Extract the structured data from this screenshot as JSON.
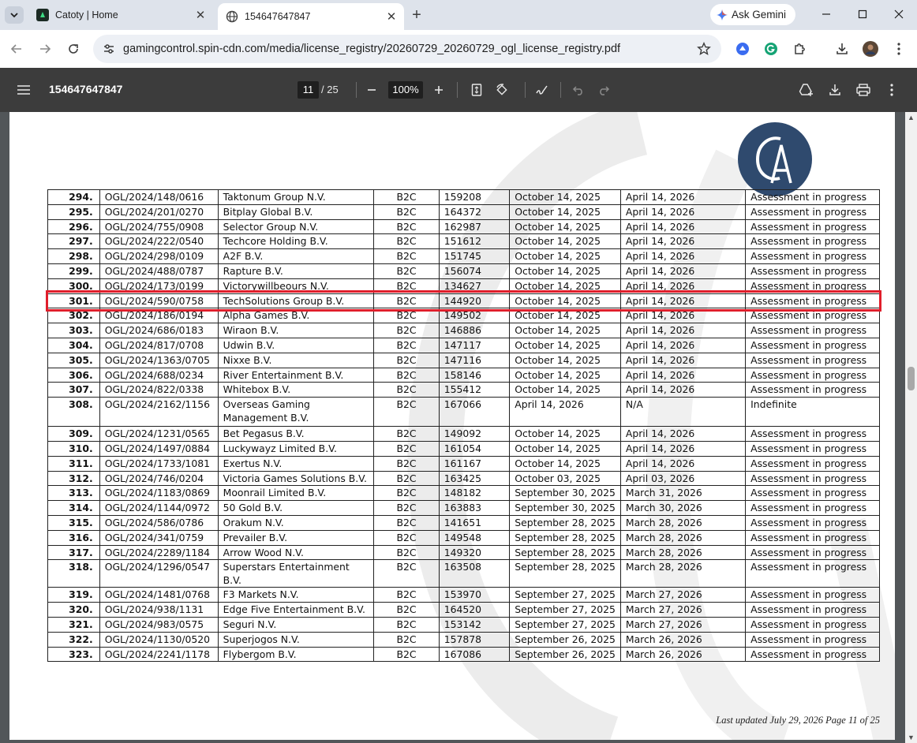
{
  "browser": {
    "tabs": [
      {
        "title": "Catoty | Home",
        "active": false
      },
      {
        "title": "154647647847",
        "active": true
      }
    ],
    "gemini_label": "Ask Gemini",
    "url": "gamingcontrol.spin-cdn.com/media/license_registry/20260729_20260729_ogl_license_registry.pdf"
  },
  "pdf_toolbar": {
    "title": "154647647847",
    "page_current": "11",
    "page_total": "/ 25",
    "zoom": "100%"
  },
  "registry": {
    "rows": [
      {
        "num": "294.",
        "license": "OGL/2024/148/0616",
        "company": "Taktonum Group N.V.",
        "type": "B2C",
        "id": "159208",
        "date1": "October 14, 2025",
        "date2": "April 14, 2026",
        "status": "Assessment in progress"
      },
      {
        "num": "295.",
        "license": "OGL/2024/201/0270",
        "company": "Bitplay Global B.V.",
        "type": "B2C",
        "id": "164372",
        "date1": "October 14, 2025",
        "date2": "April 14, 2026",
        "status": "Assessment in progress"
      },
      {
        "num": "296.",
        "license": "OGL/2024/755/0908",
        "company": "Selector Group N.V.",
        "type": "B2C",
        "id": "162987",
        "date1": "October 14, 2025",
        "date2": "April 14, 2026",
        "status": "Assessment in progress"
      },
      {
        "num": "297.",
        "license": "OGL/2024/222/0540",
        "company": "Techcore Holding B.V.",
        "type": "B2C",
        "id": "151612",
        "date1": "October 14, 2025",
        "date2": "April 14, 2026",
        "status": "Assessment in progress"
      },
      {
        "num": "298.",
        "license": "OGL/2024/298/0109",
        "company": "A2F B.V.",
        "type": "B2C",
        "id": "151745",
        "date1": "October 14, 2025",
        "date2": "April 14, 2026",
        "status": "Assessment in progress"
      },
      {
        "num": "299.",
        "license": "OGL/2024/488/0787",
        "company": "Rapture B.V.",
        "type": "B2C",
        "id": "156074",
        "date1": "October 14, 2025",
        "date2": "April 14, 2026",
        "status": "Assessment in progress"
      },
      {
        "num": "300.",
        "license": "OGL/2024/173/0199",
        "company": "Victorywillbeours N.V.",
        "type": "B2C",
        "id": "134627",
        "date1": "October 14, 2025",
        "date2": "April 14, 2026",
        "status": "Assessment in progress"
      },
      {
        "num": "301.",
        "license": "OGL/2024/590/0758",
        "company": "TechSolutions Group B.V.",
        "type": "B2C",
        "id": "144920",
        "date1": "October 14, 2025",
        "date2": "April 14, 2026",
        "status": "Assessment in progress"
      },
      {
        "num": "302.",
        "license": "OGL/2024/186/0194",
        "company": "Alpha Games B.V.",
        "type": "B2C",
        "id": "149502",
        "date1": "October 14, 2025",
        "date2": "April 14, 2026",
        "status": "Assessment in progress"
      },
      {
        "num": "303.",
        "license": "OGL/2024/686/0183",
        "company": "Wiraon B.V.",
        "type": "B2C",
        "id": "146886",
        "date1": "October 14, 2025",
        "date2": "April 14, 2026",
        "status": "Assessment in progress"
      },
      {
        "num": "304.",
        "license": "OGL/2024/817/0708",
        "company": "Udwin B.V.",
        "type": "B2C",
        "id": "147117",
        "date1": "October 14, 2025",
        "date2": "April 14, 2026",
        "status": "Assessment in progress"
      },
      {
        "num": "305.",
        "license": "OGL/2024/1363/0705",
        "company": "Nixxe B.V.",
        "type": "B2C",
        "id": "147116",
        "date1": "October 14, 2025",
        "date2": "April 14, 2026",
        "status": "Assessment in progress"
      },
      {
        "num": "306.",
        "license": "OGL/2024/688/0234",
        "company": "River Entertainment B.V.",
        "type": "B2C",
        "id": "158146",
        "date1": "October 14, 2025",
        "date2": "April 14, 2026",
        "status": "Assessment in progress"
      },
      {
        "num": "307.",
        "license": "OGL/2024/822/0338",
        "company": "Whitebox B.V.",
        "type": "B2C",
        "id": "155412",
        "date1": "October 14, 2025",
        "date2": "April 14, 2026",
        "status": "Assessment in progress"
      },
      {
        "num": "308.",
        "license": "OGL/2024/2162/1156",
        "company": "Overseas Gaming Management B.V.",
        "type": "B2C",
        "id": "167066",
        "date1": "April 14, 2026",
        "date2": "N/A",
        "status": "Indefinite"
      },
      {
        "num": "309.",
        "license": "OGL/2024/1231/0565",
        "company": "Bet Pegasus B.V.",
        "type": "B2C",
        "id": "149092",
        "date1": "October 14, 2025",
        "date2": "April 14, 2026",
        "status": "Assessment in progress"
      },
      {
        "num": "310.",
        "license": "OGL/2024/1497/0884",
        "company": "Luckywayz Limited B.V.",
        "type": "B2C",
        "id": "161054",
        "date1": "October 14, 2025",
        "date2": "April 14, 2026",
        "status": "Assessment in progress"
      },
      {
        "num": "311.",
        "license": "OGL/2024/1733/1081",
        "company": "Exertus N.V.",
        "type": "B2C",
        "id": "161167",
        "date1": "October 14, 2025",
        "date2": "April 14, 2026",
        "status": "Assessment in progress"
      },
      {
        "num": "312.",
        "license": "OGL/2024/746/0204",
        "company": "Victoria Games Solutions B.V.",
        "type": "B2C",
        "id": "163425",
        "date1": "October 03, 2025",
        "date2": "April 03, 2026",
        "status": "Assessment in progress"
      },
      {
        "num": "313.",
        "license": "OGL/2024/1183/0869",
        "company": "Moonrail Limited B.V.",
        "type": "B2C",
        "id": "148182",
        "date1": "September 30, 2025",
        "date2": "March 31, 2026",
        "status": "Assessment in progress"
      },
      {
        "num": "314.",
        "license": "OGL/2024/1144/0972",
        "company": "50 Gold B.V.",
        "type": "B2C",
        "id": "163883",
        "date1": "September 30, 2025",
        "date2": "March 30, 2026",
        "status": "Assessment in progress"
      },
      {
        "num": "315.",
        "license": "OGL/2024/586/0786",
        "company": "Orakum N.V.",
        "type": "B2C",
        "id": "141651",
        "date1": "September 28, 2025",
        "date2": "March 28, 2026",
        "status": "Assessment in progress"
      },
      {
        "num": "316.",
        "license": "OGL/2024/341/0759",
        "company": "Prevailer B.V.",
        "type": "B2C",
        "id": "149548",
        "date1": "September 28, 2025",
        "date2": "March 28, 2026",
        "status": "Assessment in progress"
      },
      {
        "num": "317.",
        "license": "OGL/2024/2289/1184",
        "company": "Arrow Wood N.V.",
        "type": "B2C",
        "id": "149320",
        "date1": "September 28, 2025",
        "date2": "March 28, 2026",
        "status": "Assessment in progress"
      },
      {
        "num": "318.",
        "license": "OGL/2024/1296/0547",
        "company": "Superstars Entertainment B.V.",
        "type": "B2C",
        "id": "163508",
        "date1": "September 28, 2025",
        "date2": "March 28, 2026",
        "status": "Assessment in progress"
      },
      {
        "num": "319.",
        "license": "OGL/2024/1481/0768",
        "company": "F3 Markets N.V.",
        "type": "B2C",
        "id": "153970",
        "date1": "September 27, 2025",
        "date2": "March 27, 2026",
        "status": "Assessment in progress"
      },
      {
        "num": "320.",
        "license": "OGL/2024/938/1131",
        "company": "Edge Five Entertainment B.V.",
        "type": "B2C",
        "id": "164520",
        "date1": "September 27, 2025",
        "date2": "March 27, 2026",
        "status": "Assessment in progress"
      },
      {
        "num": "321.",
        "license": "OGL/2024/983/0575",
        "company": "Seguri N.V.",
        "type": "B2C",
        "id": "153142",
        "date1": "September 27, 2025",
        "date2": "March 27, 2026",
        "status": "Assessment in progress"
      },
      {
        "num": "322.",
        "license": "OGL/2024/1130/0520",
        "company": "Superjogos N.V.",
        "type": "B2C",
        "id": "157878",
        "date1": "September 26, 2025",
        "date2": "March 26, 2026",
        "status": "Assessment in progress"
      },
      {
        "num": "323.",
        "license": "OGL/2024/2241/1178",
        "company": "Flybergom B.V.",
        "type": "B2C",
        "id": "167086",
        "date1": "September 26, 2025",
        "date2": "March 26, 2026",
        "status": "Assessment in progress"
      }
    ],
    "highlighted_row": "301."
  },
  "footer": "Last updated July 29, 2026  Page 11 of 25",
  "colors": {
    "highlight": "#e01e2b",
    "logo_bg": "#2f4a6e",
    "pdf_toolbar": "#3c3c3c"
  }
}
